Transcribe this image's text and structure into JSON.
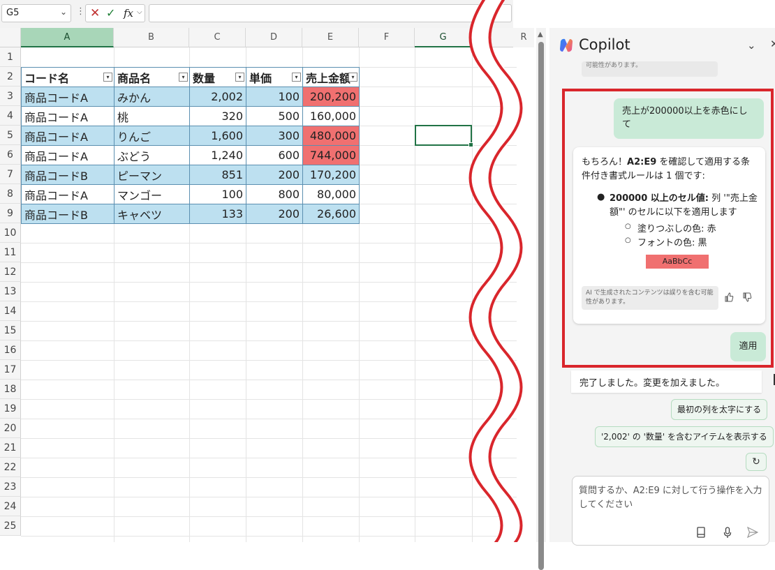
{
  "formula_bar": {
    "name_box": "G5",
    "dropdown_glyph": "⌄",
    "more_glyph": "⋮",
    "cancel_glyph": "✕",
    "enter_glyph": "✓",
    "fx_label": "fx",
    "fx_arrow_glyph": "⌵",
    "formula_value": ""
  },
  "grid": {
    "column_headers": [
      "A",
      "B",
      "C",
      "D",
      "E",
      "F",
      "G"
    ],
    "right_column_header": "R",
    "row_numbers": [
      "1",
      "2",
      "3",
      "4",
      "5",
      "6",
      "7",
      "8",
      "9",
      "10",
      "11",
      "12",
      "13",
      "14",
      "15",
      "16",
      "17",
      "18",
      "19",
      "20",
      "21",
      "22",
      "23",
      "24",
      "25"
    ],
    "selected_cell": "G5"
  },
  "table": {
    "headers": [
      "コード名",
      "商品名",
      "数量",
      "単価",
      "売上金額"
    ],
    "filter_glyph": "▾",
    "rows": [
      {
        "code": "商品コードA",
        "name": "みかん",
        "qty": "2,002",
        "price": "100",
        "sales": "200,200",
        "highlight": true
      },
      {
        "code": "商品コードA",
        "name": "桃",
        "qty": "320",
        "price": "500",
        "sales": "160,000",
        "highlight": false
      },
      {
        "code": "商品コードA",
        "name": "りんご",
        "qty": "1,600",
        "price": "300",
        "sales": "480,000",
        "highlight": true
      },
      {
        "code": "商品コードA",
        "name": "ぶどう",
        "qty": "1,240",
        "price": "600",
        "sales": "744,000",
        "highlight": true
      },
      {
        "code": "商品コードB",
        "name": "ピーマン",
        "qty": "851",
        "price": "200",
        "sales": "170,200",
        "highlight": false
      },
      {
        "code": "商品コードA",
        "name": "マンゴー",
        "qty": "100",
        "price": "800",
        "sales": "80,000",
        "highlight": false
      },
      {
        "code": "商品コードB",
        "name": "キャベツ",
        "qty": "133",
        "price": "200",
        "sales": "26,600",
        "highlight": false
      }
    ]
  },
  "copilot": {
    "title": "Copilot",
    "collapse_glyph": "⌄",
    "close_glyph": "✕",
    "previous_note": "可能性があります。",
    "user_message": "売上が200000以上を赤色にして",
    "ai": {
      "intro_prefix": "もちろん！",
      "intro_range": "A2:E9",
      "intro_suffix": " を確認して適用する条件付き書式ルールは 1 個です:",
      "rule_bold": "200000 以上のセル値:",
      "rule_rest": " 列 '\"売上金額\"' のセルに以下を適用します",
      "fill_label": "塗りつぶしの色: 赤",
      "font_label": "フォントの色: 黒",
      "preview_text": "AaBbCc",
      "disclaimer": "AI で生成されたコンテンツは誤りを含む可能性があります。",
      "thumbs_up_glyph": "👍",
      "thumbs_down_glyph": "👎"
    },
    "apply_label": "適用",
    "done_message": "完了しました。変更を加えました。",
    "suggestions": [
      "最初の列を太字にする",
      "'2,002' の '数量' を含むアイテムを表示する"
    ],
    "refresh_glyph": "↻",
    "input_placeholder": "質問するか、A2:E9 に対して行う操作を入力してください",
    "book_glyph": "▯",
    "mic_glyph": "🎙",
    "send_glyph": "➤"
  },
  "colors": {
    "excel_green": "#217346",
    "band_blue": "#bde0f0",
    "highlight_red": "#f07070",
    "callout_red": "#d9262c",
    "copilot_bubble": "#c9ead7"
  }
}
